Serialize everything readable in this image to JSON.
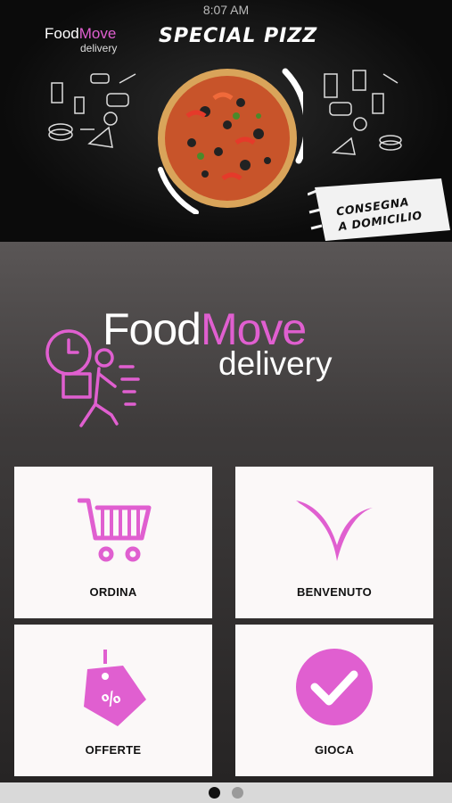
{
  "status_bar": {
    "time": "8:07 AM"
  },
  "hero": {
    "logo_primary": "Food",
    "logo_accent": "Move",
    "logo_sub": "delivery",
    "headline": "SPECIAL PIZZ",
    "banner_line1": "CONSEGNA",
    "banner_line2": "A DOMICILIO"
  },
  "brand": {
    "primary": "Food",
    "accent": "Move",
    "sub": "delivery",
    "accent_color": "#e05fd0"
  },
  "menu": {
    "items": [
      {
        "label": "ORDINA",
        "icon": "cart-icon"
      },
      {
        "label": "BENVENUTO",
        "icon": "v-logo-icon"
      },
      {
        "label": "OFFERTE",
        "icon": "price-tag-icon"
      },
      {
        "label": "GIOCA",
        "icon": "checkmark-icon"
      }
    ]
  },
  "pager": {
    "pages": 2,
    "active": 1
  }
}
